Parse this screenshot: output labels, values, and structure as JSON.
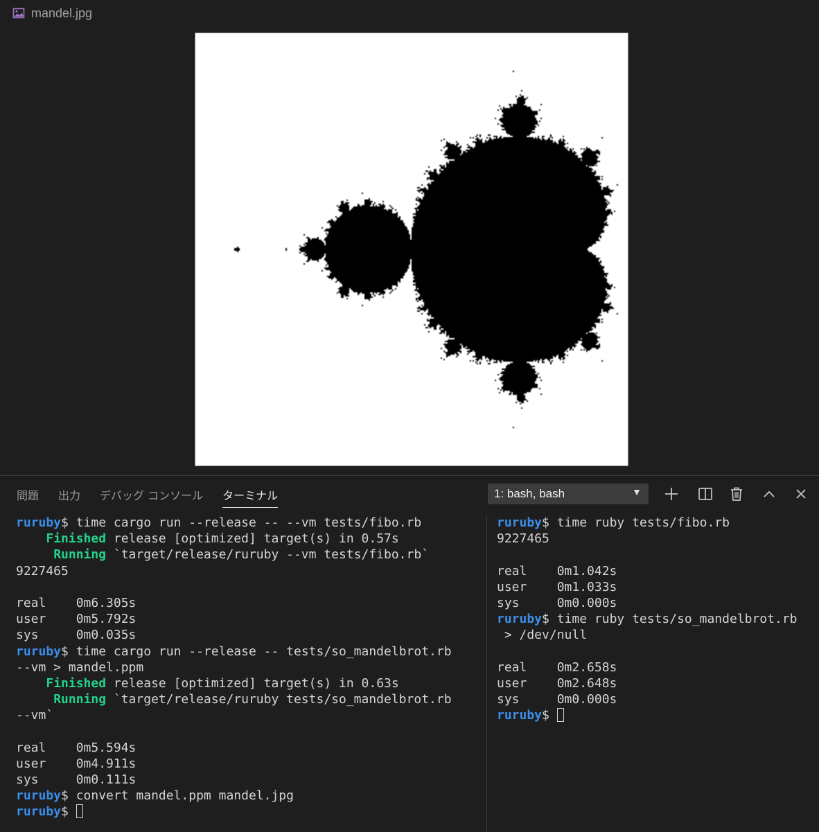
{
  "editor_tab": {
    "label": "mandel.jpg",
    "icon": "image-file-icon"
  },
  "panel_tabs": [
    {
      "label": "問題",
      "active": false
    },
    {
      "label": "出力",
      "active": false
    },
    {
      "label": "デバッグ コンソール",
      "active": false
    },
    {
      "label": "ターミナル",
      "active": true
    }
  ],
  "terminal_select": {
    "value": "1: bash, bash"
  },
  "toolbar_icons": [
    "plus-icon",
    "split-icon",
    "trash-icon",
    "chevron-up-icon",
    "close-icon"
  ],
  "colors": {
    "prompt": "#3b8eea",
    "green": "#23d18b",
    "background": "#1e1e1e"
  },
  "terminal_left": [
    [
      {
        "t": "ruruby",
        "c": "prompt"
      },
      {
        "t": "$ time cargo run --release -- --vm tests/fibo.rb"
      }
    ],
    [
      {
        "t": "    "
      },
      {
        "t": "Finished",
        "c": "green"
      },
      {
        "t": " release [optimized] target(s) in 0.57s"
      }
    ],
    [
      {
        "t": "     "
      },
      {
        "t": "Running",
        "c": "green"
      },
      {
        "t": " `target/release/ruruby --vm tests/fibo.rb`"
      }
    ],
    [
      {
        "t": "9227465"
      }
    ],
    [
      {
        "t": ""
      }
    ],
    [
      {
        "t": "real    0m6.305s"
      }
    ],
    [
      {
        "t": "user    0m5.792s"
      }
    ],
    [
      {
        "t": "sys     0m0.035s"
      }
    ],
    [
      {
        "t": "ruruby",
        "c": "prompt"
      },
      {
        "t": "$ time cargo run --release -- tests/so_mandelbrot.rb"
      }
    ],
    [
      {
        "t": "--vm > mandel.ppm"
      }
    ],
    [
      {
        "t": "    "
      },
      {
        "t": "Finished",
        "c": "green"
      },
      {
        "t": " release [optimized] target(s) in 0.63s"
      }
    ],
    [
      {
        "t": "     "
      },
      {
        "t": "Running",
        "c": "green"
      },
      {
        "t": " `target/release/ruruby tests/so_mandelbrot.rb"
      }
    ],
    [
      {
        "t": "--vm`"
      }
    ],
    [
      {
        "t": ""
      }
    ],
    [
      {
        "t": "real    0m5.594s"
      }
    ],
    [
      {
        "t": "user    0m4.911s"
      }
    ],
    [
      {
        "t": "sys     0m0.111s"
      }
    ],
    [
      {
        "t": "ruruby",
        "c": "prompt"
      },
      {
        "t": "$ convert mandel.ppm mandel.jpg"
      }
    ],
    [
      {
        "t": "ruruby",
        "c": "prompt"
      },
      {
        "t": "$ "
      },
      {
        "t": "",
        "c": "cursor"
      }
    ]
  ],
  "terminal_right": [
    [
      {
        "t": "ruruby",
        "c": "prompt"
      },
      {
        "t": "$ time ruby tests/fibo.rb"
      }
    ],
    [
      {
        "t": "9227465"
      }
    ],
    [
      {
        "t": ""
      }
    ],
    [
      {
        "t": "real    0m1.042s"
      }
    ],
    [
      {
        "t": "user    0m1.033s"
      }
    ],
    [
      {
        "t": "sys     0m0.000s"
      }
    ],
    [
      {
        "t": "ruruby",
        "c": "prompt"
      },
      {
        "t": "$ time ruby tests/so_mandelbrot.rb"
      }
    ],
    [
      {
        "t": " > /dev/null"
      }
    ],
    [
      {
        "t": ""
      }
    ],
    [
      {
        "t": "real    0m2.658s"
      }
    ],
    [
      {
        "t": "user    0m2.648s"
      }
    ],
    [
      {
        "t": "sys     0m0.000s"
      }
    ],
    [
      {
        "t": "ruruby",
        "c": "prompt"
      },
      {
        "t": "$ "
      },
      {
        "t": "",
        "c": "cursor"
      }
    ]
  ]
}
